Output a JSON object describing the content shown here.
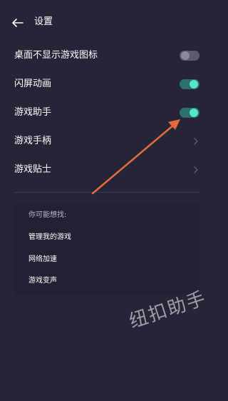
{
  "header": {
    "title": "设置"
  },
  "settings": {
    "hide_desktop_icon": {
      "label": "桌面不显示游戏图标",
      "enabled": false
    },
    "splash_animation": {
      "label": "闪屏动画",
      "enabled": true
    },
    "game_assistant": {
      "label": "游戏助手",
      "enabled": true
    },
    "gamepad": {
      "label": "游戏手柄"
    },
    "tips": {
      "label": "游戏贴士"
    }
  },
  "suggestions": {
    "title": "你可能想找:",
    "items": [
      "管理我的游戏",
      "网络加速",
      "游戏变声"
    ]
  },
  "colors": {
    "background": "#262538",
    "toggle_on_track": "#2f6f6a",
    "toggle_on_knob": "#54e6c8",
    "toggle_off_track": "#5b5a6e",
    "toggle_off_knob": "#8a899c",
    "annotation_arrow": "#e66a3a"
  },
  "watermark": "纽扣助手"
}
